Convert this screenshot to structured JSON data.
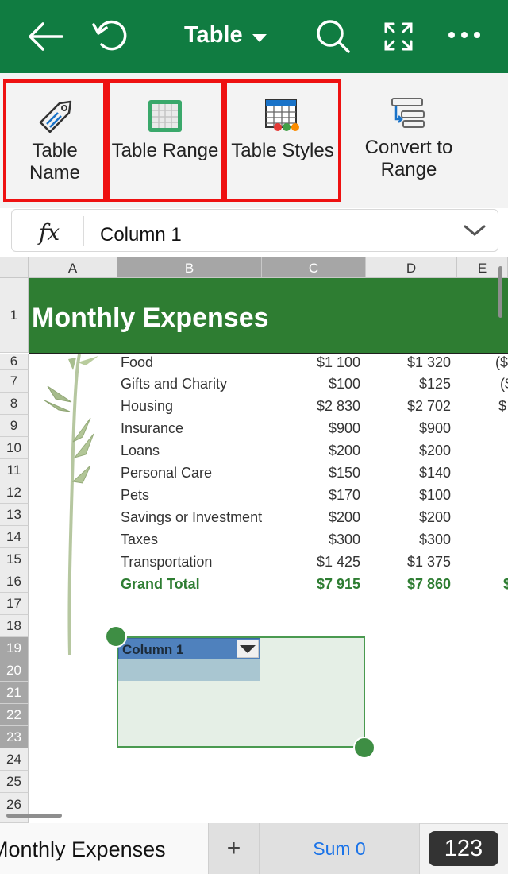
{
  "topbar": {
    "title": "Table",
    "icons": [
      "back-arrow-icon",
      "undo-icon",
      "search-icon",
      "fullscreen-icon",
      "more-icon"
    ],
    "background": "#107c41"
  },
  "ribbon": {
    "buttons": [
      {
        "label": "Table Name",
        "icon": "tag-icon"
      },
      {
        "label": "Table Range",
        "icon": "table-range-icon"
      },
      {
        "label": "Table Styles",
        "icon": "table-styles-icon"
      },
      {
        "label": "Convert to Range",
        "icon": "convert-range-icon"
      }
    ]
  },
  "formula_bar": {
    "fx": "fx",
    "value": "Column 1"
  },
  "columns": [
    "A",
    "B",
    "C",
    "D",
    "E"
  ],
  "rows": [
    "1",
    "6",
    "7",
    "8",
    "9",
    "10",
    "11",
    "12",
    "13",
    "14",
    "15",
    "16",
    "17",
    "18",
    "19",
    "20",
    "21",
    "22",
    "23",
    "24",
    "25",
    "26"
  ],
  "banner_title": "Monthly Expenses",
  "expenses": [
    {
      "category": "Food",
      "c": "$1 100",
      "d": "$1 320",
      "e": "($"
    },
    {
      "category": "Gifts and Charity",
      "c": "$100",
      "d": "$125",
      "e": "($"
    },
    {
      "category": "Housing",
      "c": "$2 830",
      "d": "$2 702",
      "e": "$"
    },
    {
      "category": "Insurance",
      "c": "$900",
      "d": "$900",
      "e": ""
    },
    {
      "category": "Loans",
      "c": "$200",
      "d": "$200",
      "e": ""
    },
    {
      "category": "Personal Care",
      "c": "$150",
      "d": "$140",
      "e": ""
    },
    {
      "category": "Pets",
      "c": "$170",
      "d": "$100",
      "e": ""
    },
    {
      "category": "Savings or Investment",
      "c": "$200",
      "d": "$200",
      "e": ""
    },
    {
      "category": "Taxes",
      "c": "$300",
      "d": "$300",
      "e": ""
    },
    {
      "category": "Transportation",
      "c": "$1 425",
      "d": "$1 375",
      "e": ""
    }
  ],
  "grand_total": {
    "label": "Grand Total",
    "c": "$7 915",
    "d": "$7 860",
    "e": "$"
  },
  "table": {
    "header": "Column 1"
  },
  "bottom": {
    "sheet_name": "Monthly Expenses",
    "add_sheet": "+",
    "sum": "Sum 0",
    "keyboard": "123"
  }
}
